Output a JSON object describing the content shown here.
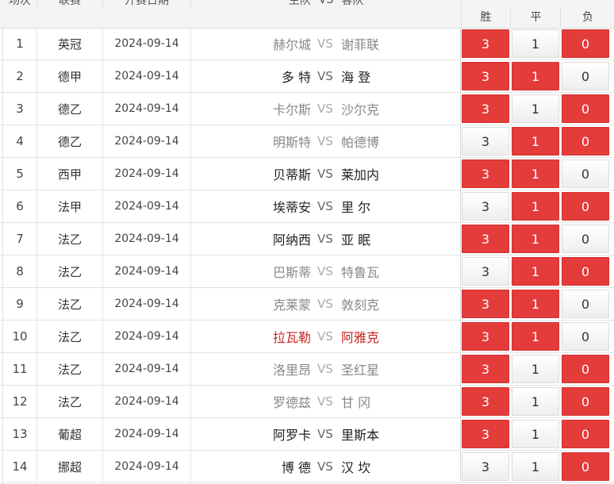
{
  "header": {
    "col_num": "场次",
    "col_league": "联赛",
    "col_date": "开赛日期",
    "col_home": "主队",
    "col_vs": "VS",
    "col_away": "客队",
    "opt_win": "胜",
    "opt_draw": "平",
    "opt_lose": "负"
  },
  "colors": {
    "accent_red": "#e43b3b",
    "text_red": "#cc2222"
  },
  "rows": [
    {
      "num": "1",
      "league": "英冠",
      "date": "2024-09-14",
      "home": "赫尔城",
      "vs": "VS",
      "away": "谢菲联",
      "win": "3",
      "draw": "1",
      "lose": "0",
      "sel": [
        true,
        false,
        true
      ],
      "style": "gray"
    },
    {
      "num": "2",
      "league": "德甲",
      "date": "2024-09-14",
      "home": "多 特",
      "vs": "VS",
      "away": "海 登",
      "win": "3",
      "draw": "1",
      "lose": "0",
      "sel": [
        true,
        true,
        false
      ],
      "style": "black"
    },
    {
      "num": "3",
      "league": "德乙",
      "date": "2024-09-14",
      "home": "卡尔斯",
      "vs": "VS",
      "away": "沙尔克",
      "win": "3",
      "draw": "1",
      "lose": "0",
      "sel": [
        true,
        false,
        true
      ],
      "style": "gray"
    },
    {
      "num": "4",
      "league": "德乙",
      "date": "2024-09-14",
      "home": "明斯特",
      "vs": "VS",
      "away": "帕德博",
      "win": "3",
      "draw": "1",
      "lose": "0",
      "sel": [
        false,
        true,
        true
      ],
      "style": "gray"
    },
    {
      "num": "5",
      "league": "西甲",
      "date": "2024-09-14",
      "home": "贝蒂斯",
      "vs": "VS",
      "away": "莱加内",
      "win": "3",
      "draw": "1",
      "lose": "0",
      "sel": [
        true,
        true,
        false
      ],
      "style": "black"
    },
    {
      "num": "6",
      "league": "法甲",
      "date": "2024-09-14",
      "home": "埃蒂安",
      "vs": "VS",
      "away": "里 尔",
      "win": "3",
      "draw": "1",
      "lose": "0",
      "sel": [
        false,
        true,
        true
      ],
      "style": "black"
    },
    {
      "num": "7",
      "league": "法乙",
      "date": "2024-09-14",
      "home": "阿纳西",
      "vs": "VS",
      "away": "亚 眠",
      "win": "3",
      "draw": "1",
      "lose": "0",
      "sel": [
        true,
        true,
        false
      ],
      "style": "black"
    },
    {
      "num": "8",
      "league": "法乙",
      "date": "2024-09-14",
      "home": "巴斯蒂",
      "vs": "VS",
      "away": "特鲁瓦",
      "win": "3",
      "draw": "1",
      "lose": "0",
      "sel": [
        false,
        true,
        true
      ],
      "style": "gray"
    },
    {
      "num": "9",
      "league": "法乙",
      "date": "2024-09-14",
      "home": "克莱蒙",
      "vs": "VS",
      "away": "敦刻克",
      "win": "3",
      "draw": "1",
      "lose": "0",
      "sel": [
        true,
        true,
        false
      ],
      "style": "gray"
    },
    {
      "num": "10",
      "league": "法乙",
      "date": "2024-09-14",
      "home": "拉瓦勒",
      "vs": "VS",
      "away": "阿雅克",
      "win": "3",
      "draw": "1",
      "lose": "0",
      "sel": [
        true,
        true,
        false
      ],
      "style": "red"
    },
    {
      "num": "11",
      "league": "法乙",
      "date": "2024-09-14",
      "home": "洛里昂",
      "vs": "VS",
      "away": "圣红星",
      "win": "3",
      "draw": "1",
      "lose": "0",
      "sel": [
        true,
        false,
        true
      ],
      "style": "gray"
    },
    {
      "num": "12",
      "league": "法乙",
      "date": "2024-09-14",
      "home": "罗德兹",
      "vs": "VS",
      "away": "甘 冈",
      "win": "3",
      "draw": "1",
      "lose": "0",
      "sel": [
        true,
        false,
        true
      ],
      "style": "gray"
    },
    {
      "num": "13",
      "league": "葡超",
      "date": "2024-09-14",
      "home": "阿罗卡",
      "vs": "VS",
      "away": "里斯本",
      "win": "3",
      "draw": "1",
      "lose": "0",
      "sel": [
        true,
        false,
        true
      ],
      "style": "black"
    },
    {
      "num": "14",
      "league": "挪超",
      "date": "2024-09-14",
      "home": "博 德",
      "vs": "VS",
      "away": "汉 坎",
      "win": "3",
      "draw": "1",
      "lose": "0",
      "sel": [
        false,
        false,
        true
      ],
      "style": "black"
    }
  ]
}
